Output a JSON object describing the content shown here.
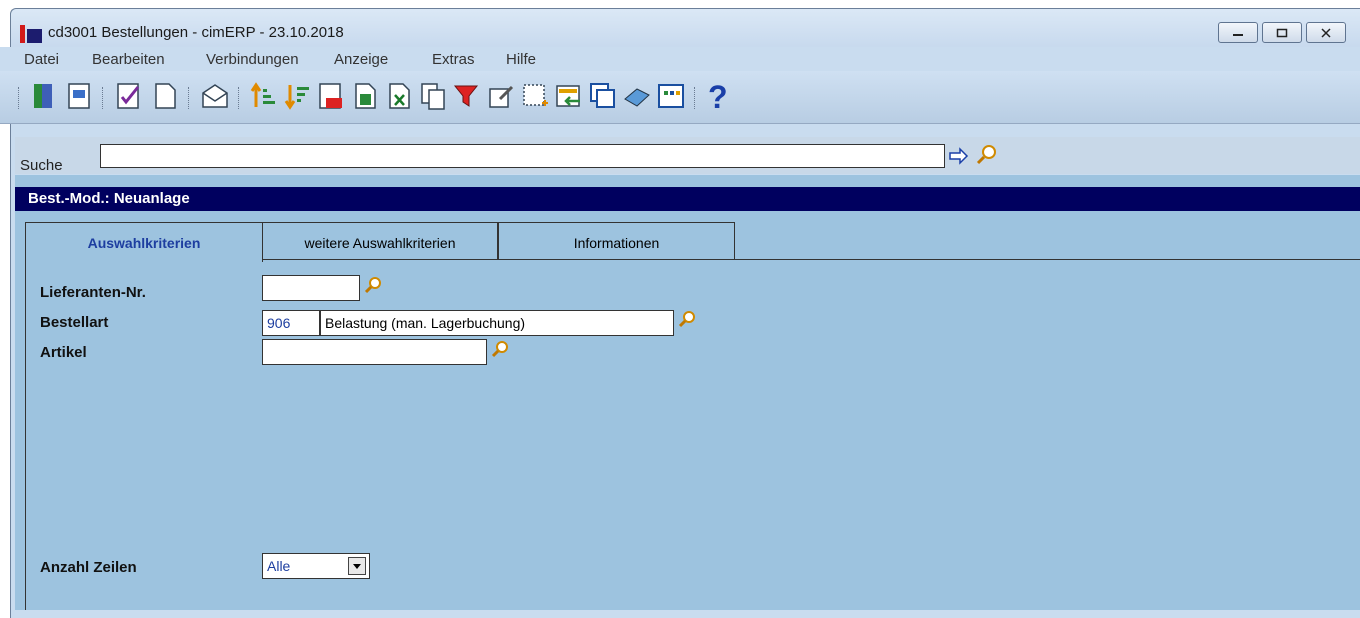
{
  "window": {
    "title": "cd3001 Bestellungen - cimERP - 23.10.2018"
  },
  "menu": [
    "Datei",
    "Bearbeiten",
    "Verbindungen",
    "Anzeige",
    "Extras",
    "Hilfe"
  ],
  "search": {
    "label": "Suche",
    "value": ""
  },
  "banner": "Best.-Mod.: Neuanlage",
  "tabs": [
    "Auswahlkriterien",
    "weitere Auswahlkriterien",
    "Informationen"
  ],
  "form": {
    "lieferant_label": "Lieferanten-Nr.",
    "lieferant_value": "",
    "bestellart_label": "Bestellart",
    "bestellart_code": "906",
    "bestellart_desc": "Belastung (man. Lagerbuchung)",
    "artikel_label": "Artikel",
    "artikel_value": "",
    "zeilen_label": "Anzahl Zeilen",
    "zeilen_value": "Alle"
  },
  "colors": {
    "banner": "#00005f",
    "panel": "#9dc3df",
    "active_tab_text": "#1d3ea0"
  }
}
